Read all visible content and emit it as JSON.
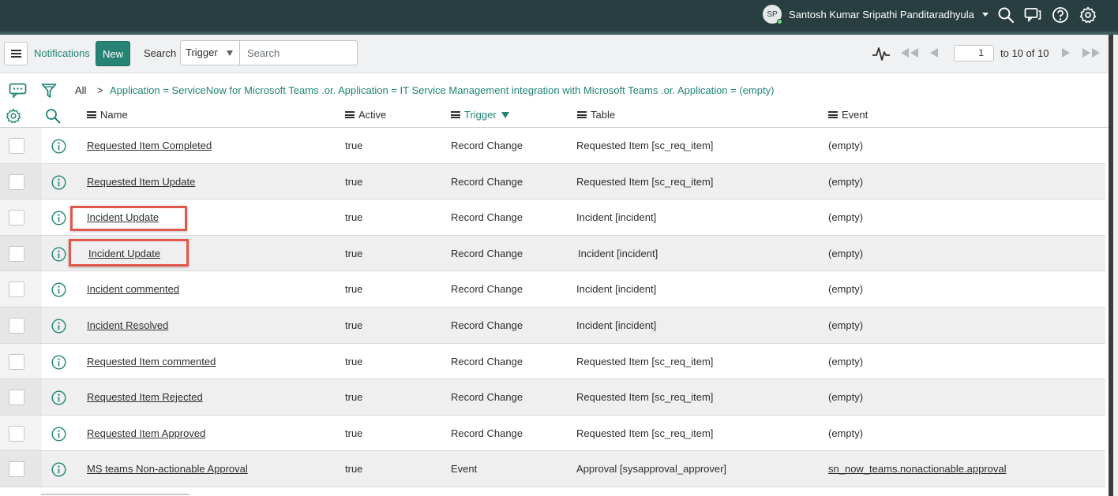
{
  "header": {
    "user_initials": "SP",
    "user_name": "Santosh Kumar Sripathi Panditaradhyula",
    "icons": [
      "search-icon",
      "chat-icon",
      "help-icon",
      "gear-icon"
    ]
  },
  "toolbar": {
    "list_title": "Notifications",
    "new_label": "New",
    "search_label": "Search",
    "search_field": "Trigger",
    "search_placeholder": "Search",
    "pager": {
      "current_page": "1",
      "range_text": "to 10 of 10"
    }
  },
  "breadcrumb": {
    "all": "All",
    "separator": ">",
    "condition": "Application = ServiceNow for Microsoft Teams .or. Application = IT Service Management integration with Microsoft Teams .or. Application = (empty)"
  },
  "columns": {
    "name": "Name",
    "active": "Active",
    "trigger": "Trigger",
    "table": "Table",
    "event": "Event"
  },
  "rows": [
    {
      "name": "Requested Item Completed",
      "active": "true",
      "trigger": "Record Change",
      "table": "Requested Item [sc_req_item]",
      "event": "(empty)"
    },
    {
      "name": "Requested Item Update",
      "active": "true",
      "trigger": "Record Change",
      "table": "Requested Item [sc_req_item]",
      "event": "(empty)"
    },
    {
      "name": "Incident Update",
      "active": "true",
      "trigger": "Record Change",
      "table": "Incident [incident]",
      "event": "(empty)"
    },
    {
      "name": "Incident Update",
      "active": "true",
      "trigger": "Record Change",
      "table": "Incident [incident]",
      "event": "(empty)"
    },
    {
      "name": "Incident commented",
      "active": "true",
      "trigger": "Record Change",
      "table": "Incident [incident]",
      "event": "(empty)"
    },
    {
      "name": "Incident Resolved",
      "active": "true",
      "trigger": "Record Change",
      "table": "Incident [incident]",
      "event": "(empty)"
    },
    {
      "name": "Requested Item commented",
      "active": "true",
      "trigger": "Record Change",
      "table": "Requested Item [sc_req_item]",
      "event": "(empty)"
    },
    {
      "name": "Requested Item Rejected",
      "active": "true",
      "trigger": "Record Change",
      "table": "Requested Item [sc_req_item]",
      "event": "(empty)"
    },
    {
      "name": "Requested Item Approved",
      "active": "true",
      "trigger": "Record Change",
      "table": "Requested Item [sc_req_item]",
      "event": "(empty)"
    },
    {
      "name": "MS teams Non-actionable Approval",
      "active": "true",
      "trigger": "Event",
      "table": "Approval [sysapproval_approver]",
      "event": "sn_now_teams.nonactionable.approval"
    }
  ],
  "colors": {
    "banner": "#293e40",
    "accent": "#1f8476",
    "new_button": "#278373",
    "highlight": "#e2574c"
  }
}
